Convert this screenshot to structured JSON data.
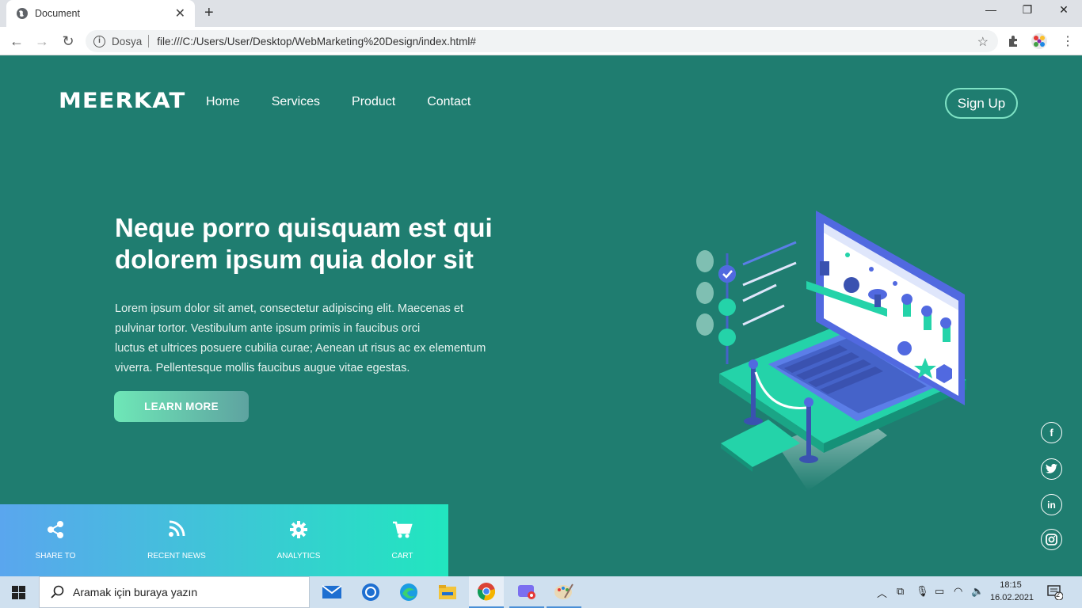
{
  "browser": {
    "tab_title": "Document",
    "address_prefix": "Dosya",
    "url": "file:///C:/Users/User/Desktop/WebMarketing%20Design/index.html#"
  },
  "site": {
    "logo": "MEERKAT",
    "nav": [
      "Home",
      "Services",
      "Product",
      "Contact"
    ],
    "signup": "Sign Up",
    "hero_title": "Neque porro quisquam est qui dolorem ipsum quia dolor sit",
    "hero_lines": [
      "Lorem ipsum dolor sit amet, consectetur adipiscing elit. Maecenas et",
      "pulvinar tortor. Vestibulum ante ipsum primis in faucibus orci",
      "luctus et ultrices posuere cubilia curae; Aenean ut risus ac ex elementum",
      "viverra. Pellentesque mollis faucibus augue vitae egestas."
    ],
    "learn_more": "LEARN MORE",
    "bottom_items": [
      {
        "label": "SHARE TO",
        "icon": "share-icon"
      },
      {
        "label": "RECENT NEWS",
        "icon": "rss-icon"
      },
      {
        "label": "ANALYTICS",
        "icon": "gear-icon"
      },
      {
        "label": "CART",
        "icon": "cart-icon"
      }
    ],
    "social": [
      "facebook-icon",
      "twitter-icon",
      "linkedin-icon",
      "instagram-icon"
    ],
    "colors": {
      "bg": "#1f7d70",
      "accent": "#21e6bf",
      "button_gradient_start": "#6ee7b7"
    }
  },
  "taskbar": {
    "search_placeholder": "Aramak için buraya yazın",
    "time": "18:15",
    "date": "16.02.2021",
    "notification_count": "2"
  }
}
